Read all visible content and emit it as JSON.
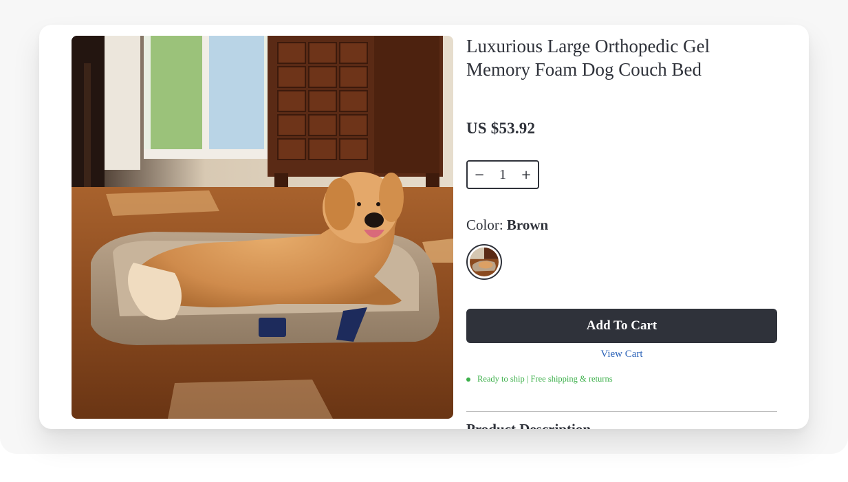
{
  "product": {
    "title": "Luxurious Large Orthopedic Gel Memory Foam Dog Couch Bed",
    "image_alt": "Golden retriever lying on a taupe orthopedic couch dog bed",
    "price": "US $53.92"
  },
  "quantity": {
    "decrement_symbol": "−",
    "value": "1",
    "increment_symbol": "+"
  },
  "color": {
    "label": "Color:",
    "selected": "Brown"
  },
  "actions": {
    "add_to_cart": "Add To Cart",
    "view_cart": "View Cart"
  },
  "shipping": {
    "status": "Ready to ship | Free shipping & returns",
    "status_color": "#3db04b"
  },
  "sections": {
    "description_heading": "Product Description"
  },
  "colors": {
    "primary": "#2f323a",
    "link": "#2c63b8",
    "background": "#f7f7f7"
  }
}
